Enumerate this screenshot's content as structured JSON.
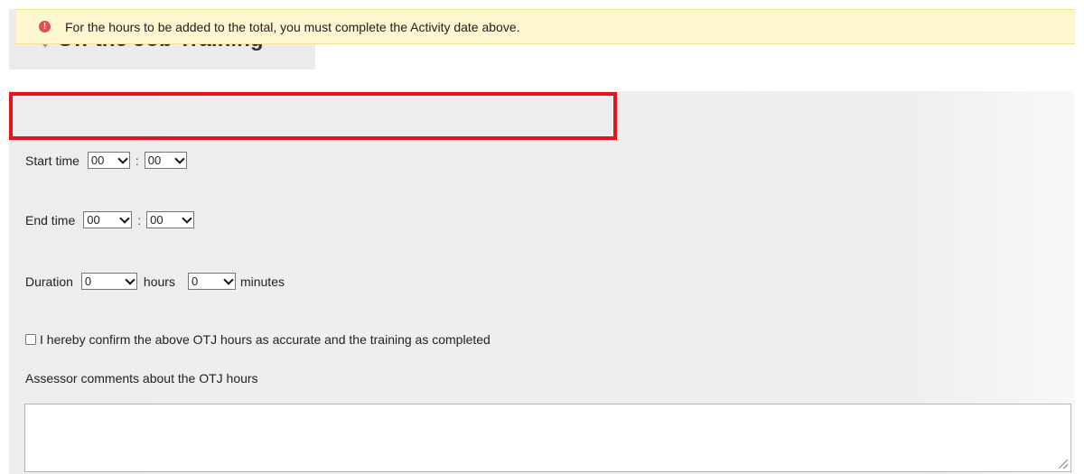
{
  "section": {
    "title": "Off the Job Training",
    "toggle_icon": "caret-down-icon"
  },
  "notice": {
    "icon": "error-icon",
    "icon_glyph": "!",
    "text": "For the hours to be added to the total, you must complete the Activity date above.",
    "highlight_color": "#e5131b",
    "background_color": "#fdf6ce"
  },
  "start_time": {
    "label": "Start time",
    "hour": "00",
    "minute": "00",
    "separator": ":"
  },
  "end_time": {
    "label": "End time",
    "hour": "00",
    "minute": "00",
    "separator": ":"
  },
  "duration": {
    "label": "Duration",
    "hours_value": "0",
    "hours_unit": "hours",
    "minutes_value": "0",
    "minutes_unit": "minutes"
  },
  "confirm": {
    "checked": false,
    "label": "I hereby confirm the above OTJ hours as accurate and the training as completed"
  },
  "comments": {
    "label": "Assessor comments about the OTJ hours",
    "value": ""
  }
}
